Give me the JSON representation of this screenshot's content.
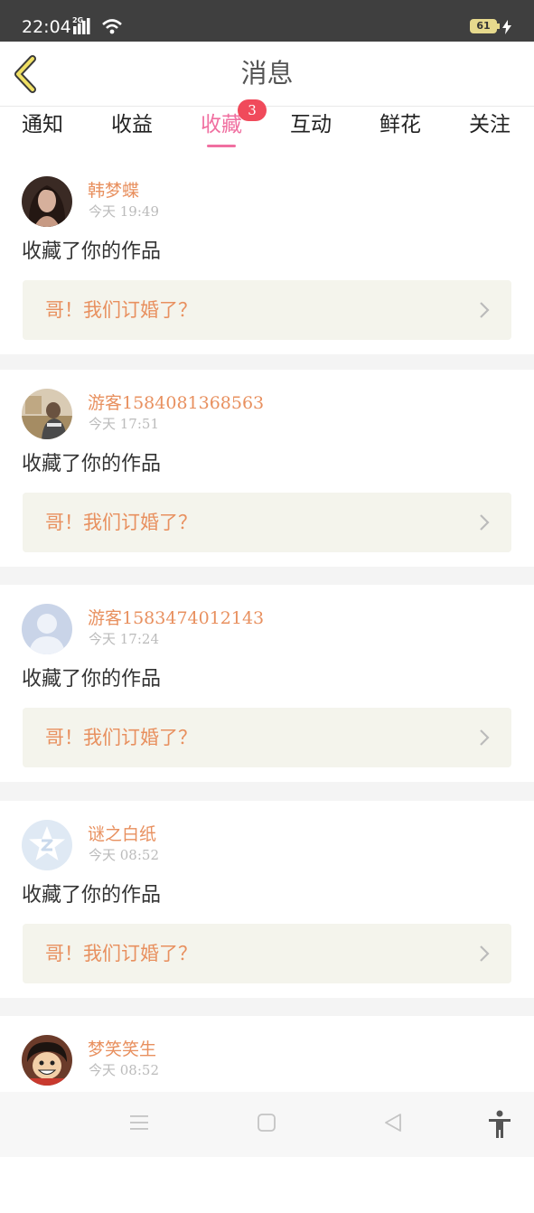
{
  "status_bar": {
    "time": "22:04",
    "network": "2G",
    "battery": "61",
    "icons": [
      "signal-icon",
      "wifi-icon",
      "battery-icon",
      "charging-icon"
    ]
  },
  "header": {
    "title": "消息",
    "back_icon": "chevron-left-icon"
  },
  "tabs": [
    {
      "label": "通知",
      "active": false
    },
    {
      "label": "收益",
      "active": false
    },
    {
      "label": "收藏",
      "active": true,
      "badge": "3"
    },
    {
      "label": "互动",
      "active": false
    },
    {
      "label": "鲜花",
      "active": false
    },
    {
      "label": "关注",
      "active": false
    }
  ],
  "messages": [
    {
      "user": "韩梦蝶",
      "time": "今天 19:49",
      "action": "收藏了你的作品",
      "work_title": "哥！我们订婚了？"
    },
    {
      "user": "游客1584081368563",
      "time": "今天 17:51",
      "action": "收藏了你的作品",
      "work_title": "哥！我们订婚了？"
    },
    {
      "user": "游客1583474012143",
      "time": "今天 17:24",
      "action": "收藏了你的作品",
      "work_title": "哥！我们订婚了？"
    },
    {
      "user": "谜之白纸",
      "time": "今天 08:52",
      "action": "收藏了你的作品",
      "work_title": "哥！我们订婚了？"
    },
    {
      "user": "梦笑笑生",
      "time": "今天 08:52"
    }
  ],
  "nav": {
    "icons": [
      "menu-icon",
      "home-square-icon",
      "back-triangle-icon",
      "accessibility-icon"
    ]
  },
  "colors": {
    "accent_pink": "#f06fa0",
    "name_orange": "#e8905f",
    "badge_red": "#f04a5b",
    "status_bar": "#3f3f3f"
  }
}
